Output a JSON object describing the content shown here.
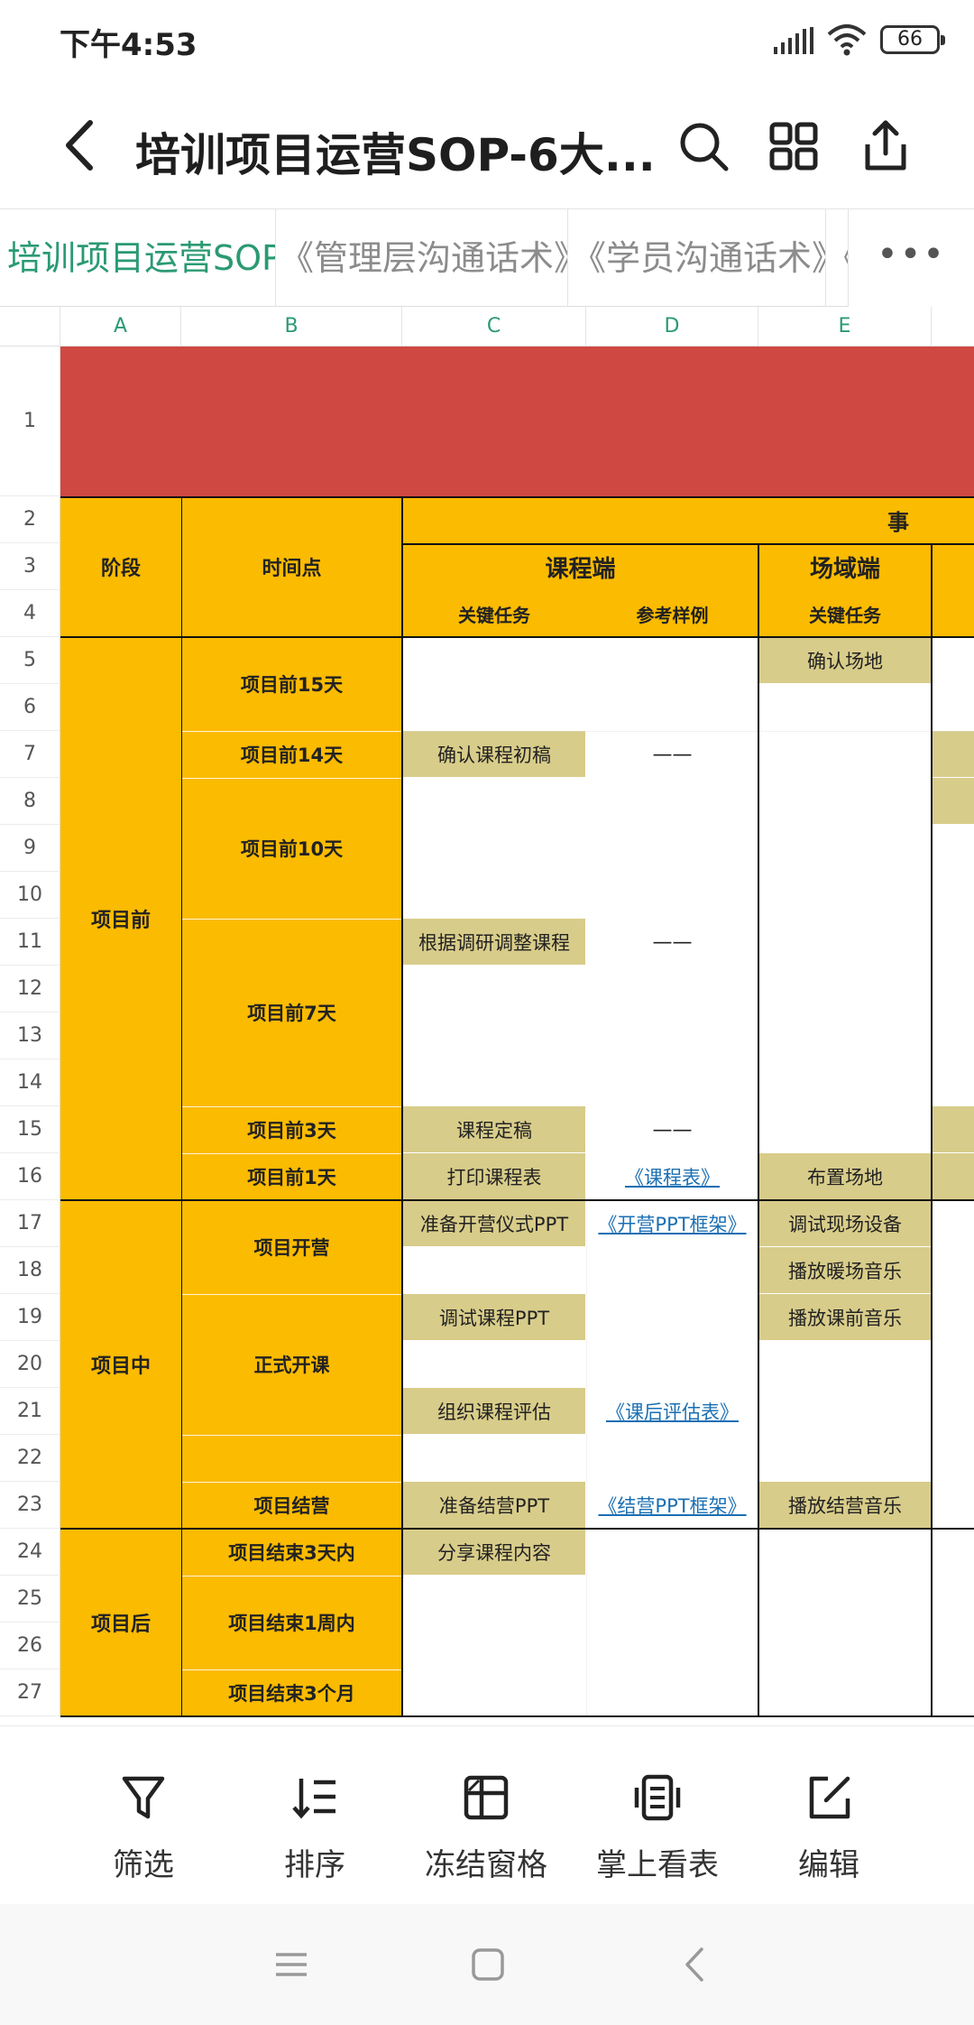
{
  "status_bar": {
    "time": "下午4:53",
    "battery": "66"
  },
  "header": {
    "title": "培训项目运营SOP-6大..."
  },
  "sheet_tabs": [
    {
      "label": "培训项目运营SOP"
    },
    {
      "label": "《管理层沟通话术》"
    },
    {
      "label": "《学员沟通话术》"
    },
    {
      "label": "《"
    }
  ],
  "more_label": "•••",
  "columns": [
    "A",
    "B",
    "C",
    "D",
    "E"
  ],
  "rows": [
    "1",
    "2",
    "3",
    "4",
    "5",
    "6",
    "7",
    "8",
    "9",
    "10",
    "11",
    "12",
    "13",
    "14",
    "15",
    "16",
    "17",
    "18",
    "19",
    "20",
    "21",
    "22",
    "23",
    "24",
    "25",
    "26",
    "27"
  ],
  "table": {
    "header": {
      "stage": "阶段",
      "timepoint": "时间点",
      "group_partial": "事",
      "course_side": "课程端",
      "venue_side": "场域端",
      "key_task_c": "关键任务",
      "ref_example": "参考样例",
      "key_task_e": "关键任务"
    },
    "stages": {
      "before": "项目前",
      "during": "项目中",
      "after": "项目后"
    },
    "timepoints": {
      "t15": "项目前15天",
      "t14": "项目前14天",
      "t10": "项目前10天",
      "t7": "项目前7天",
      "t3": "项目前3天",
      "t1": "项目前1天",
      "open": "项目开营",
      "class": "正式开课",
      "close": "项目结营",
      "a3": "项目结束3天内",
      "a1w": "项目结束1周内",
      "a3m": "项目结束3个月"
    },
    "course_tasks": {
      "r7": "确认课程初稿",
      "r11": "根据调研调整课程",
      "r15": "课程定稿",
      "r16": "打印课程表",
      "r17": "准备开营仪式PPT",
      "r19": "调试课程PPT",
      "r21": "组织课程评估",
      "r23": "准备结营PPT",
      "r24": "分享课程内容"
    },
    "references": {
      "dash": "——",
      "r16": "《课程表》",
      "r17": "《开营PPT框架》",
      "r21": "《课后评估表》",
      "r23": "《结营PPT框架》"
    },
    "venue_tasks": {
      "r5": "确认场地",
      "r16": "布置场地",
      "r17": "调试现场设备",
      "r18": "播放暖场音乐",
      "r19": "播放课前音乐",
      "r23": "播放结营音乐"
    }
  },
  "toolbar": {
    "filter": "筛选",
    "sort": "排序",
    "freeze": "冻结窗格",
    "mobile_view": "掌上看表",
    "edit": "编辑"
  },
  "colors": {
    "accent": "#2a9a72",
    "header_yellow": "#fbbb00",
    "task_khaki": "#d8cc8a",
    "banner_red": "#cf4841",
    "link_blue": "#1a6fb3"
  }
}
